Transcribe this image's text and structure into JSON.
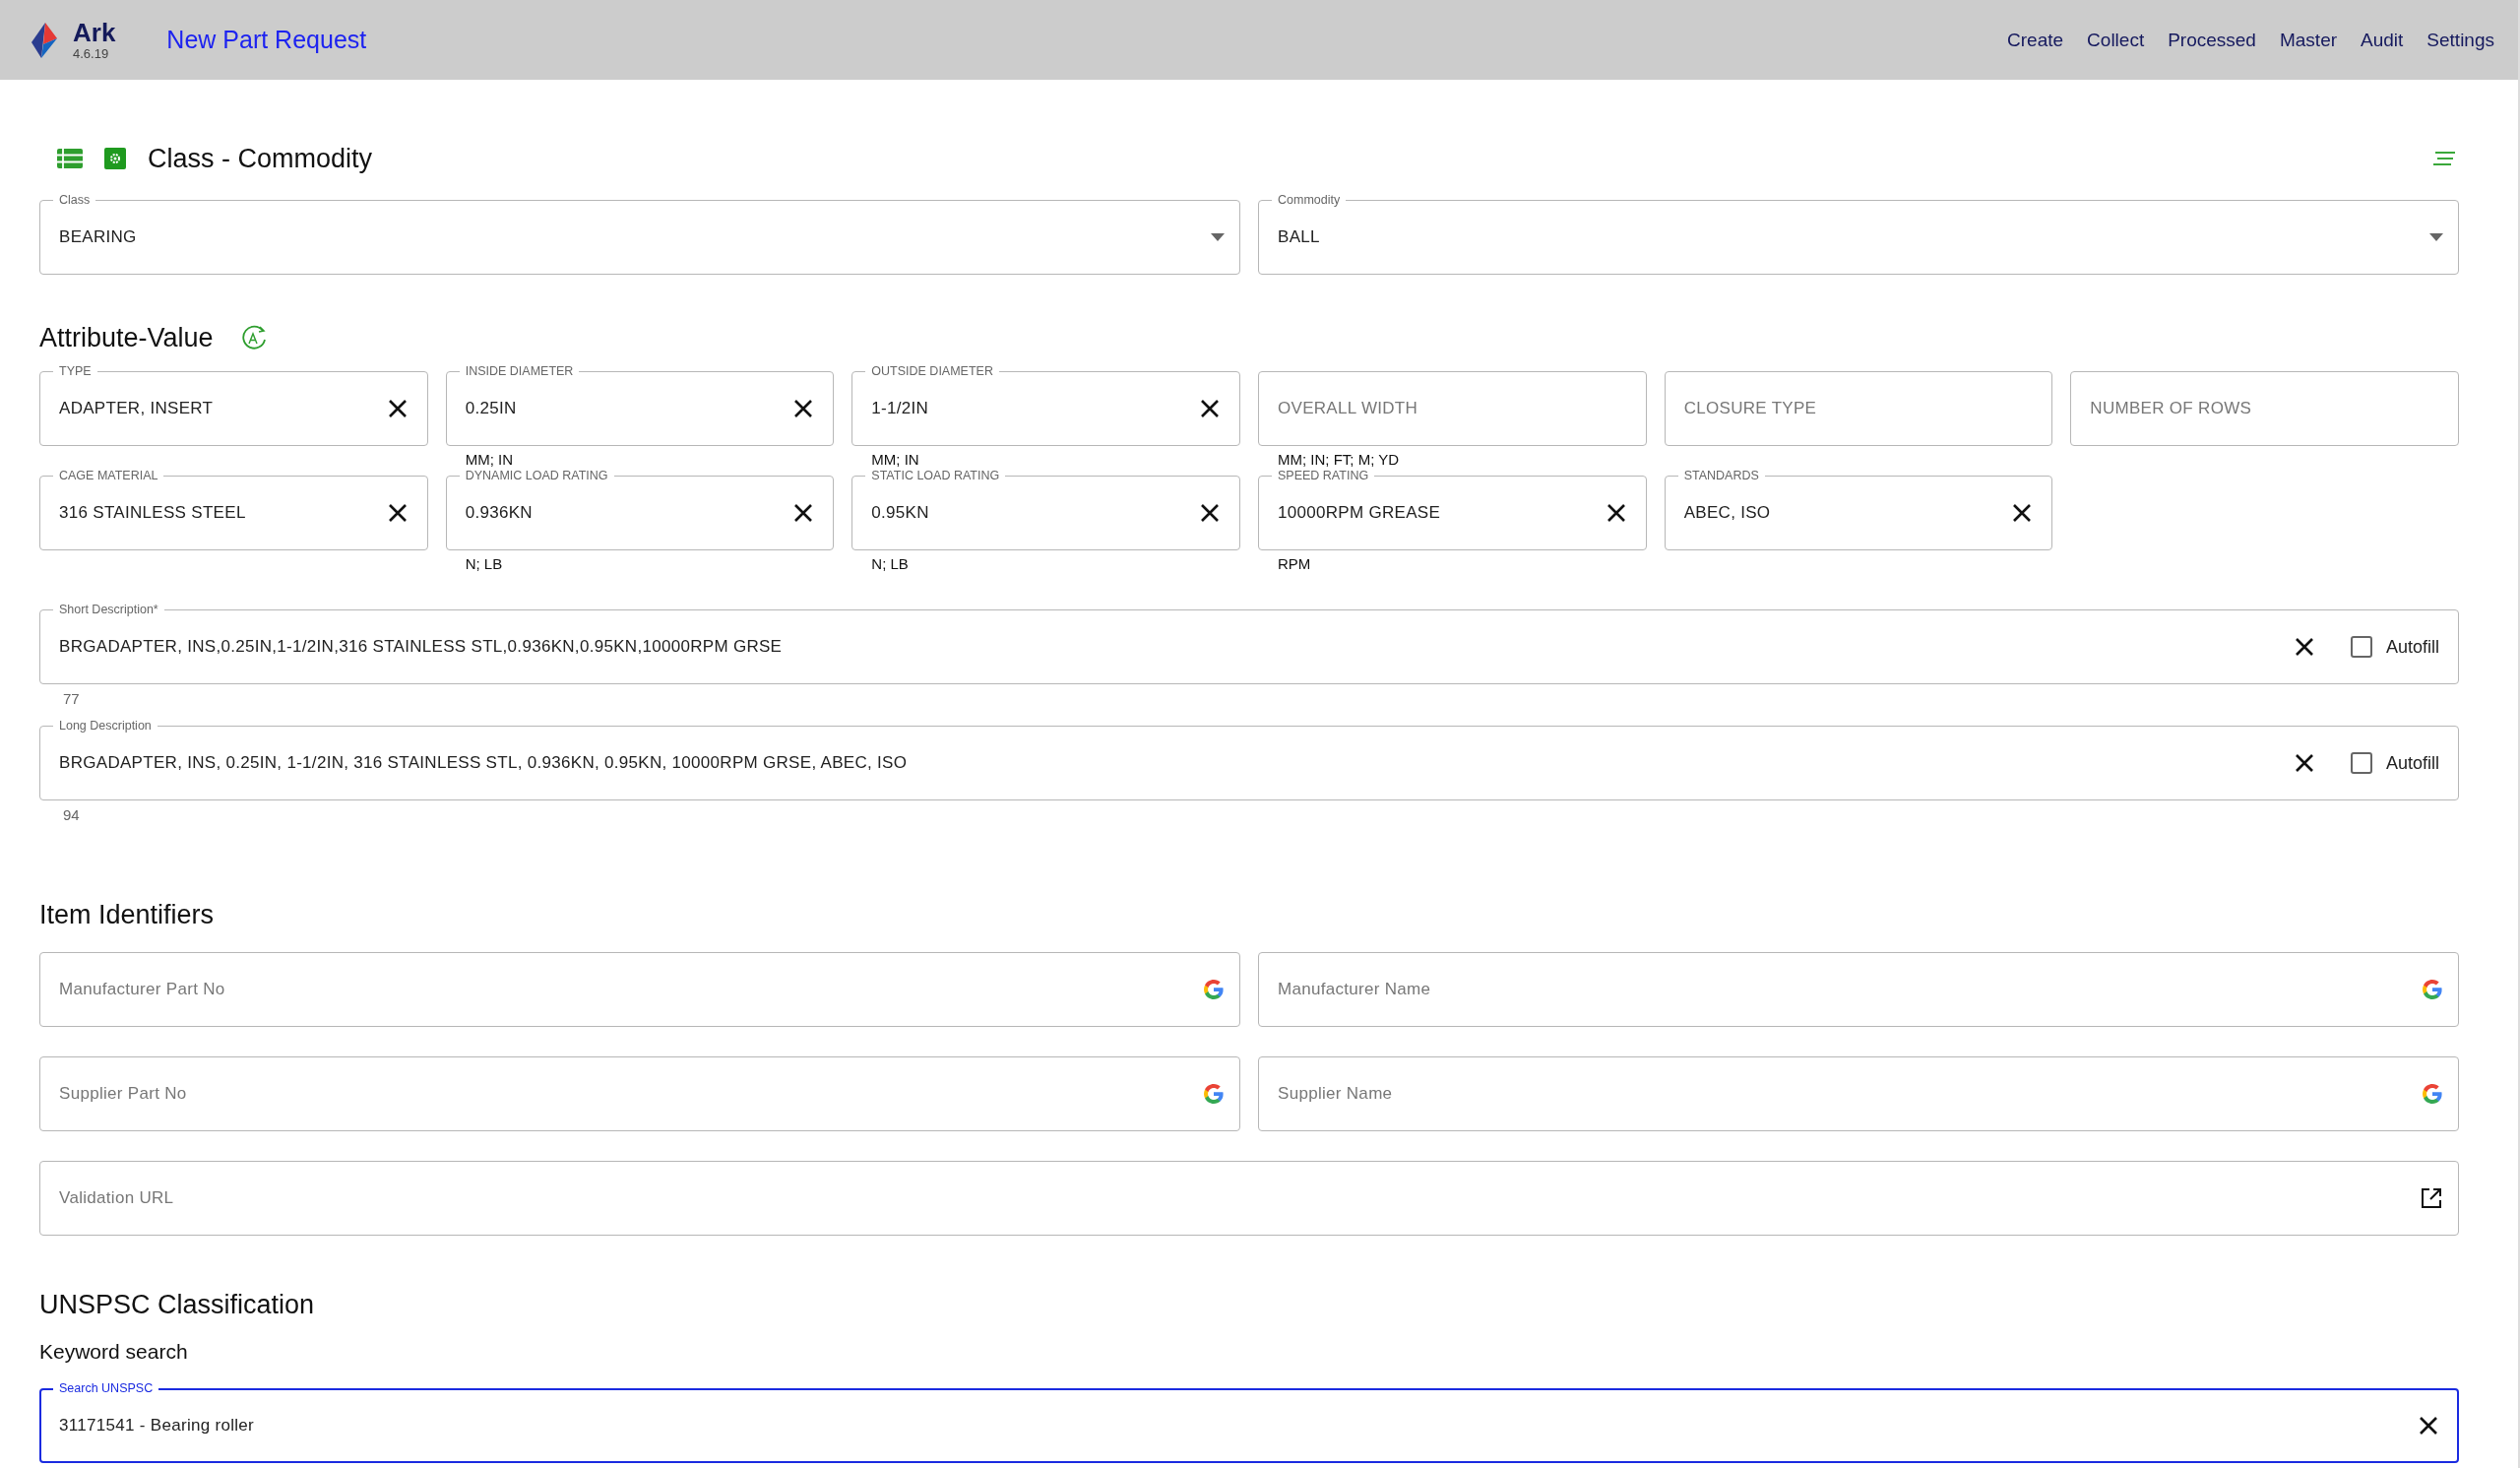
{
  "header": {
    "app_name": "Ark",
    "version": "4.6.19",
    "page_title": "New Part Request",
    "nav": [
      {
        "label": "Create"
      },
      {
        "label": "Collect"
      },
      {
        "label": "Processed"
      },
      {
        "label": "Master"
      },
      {
        "label": "Audit"
      },
      {
        "label": "Settings"
      }
    ]
  },
  "class_commodity": {
    "title": "Class - Commodity",
    "fields": [
      {
        "label": "Class",
        "value": "BEARING"
      },
      {
        "label": "Commodity",
        "value": "BALL"
      }
    ]
  },
  "attribute_value": {
    "title": "Attribute-Value",
    "attributes": [
      {
        "label": "TYPE",
        "value": "ADAPTER, INSERT"
      },
      {
        "label": "INSIDE DIAMETER",
        "value": "0.25IN",
        "hint": "MM; IN"
      },
      {
        "label": "OUTSIDE DIAMETER",
        "value": "1-1/2IN",
        "hint": "MM; IN"
      },
      {
        "placeholder": "OVERALL WIDTH",
        "hint": "MM; IN; FT; M; YD"
      },
      {
        "placeholder": "CLOSURE TYPE"
      },
      {
        "placeholder": "NUMBER OF ROWS"
      },
      {
        "label": "CAGE MATERIAL",
        "value": "316 STAINLESS STEEL"
      },
      {
        "label": "DYNAMIC LOAD RATING",
        "value": "0.936KN",
        "hint": "N; LB"
      },
      {
        "label": "STATIC LOAD RATING",
        "value": "0.95KN",
        "hint": "N; LB"
      },
      {
        "label": "SPEED RATING",
        "value": "10000RPM GREASE",
        "hint": "RPM"
      },
      {
        "label": "STANDARDS",
        "value": "ABEC, ISO"
      }
    ]
  },
  "descriptions": [
    {
      "label": "Short Description*",
      "value": "BRGADAPTER, INS,0.25IN,1-1/2IN,316 STAINLESS STL,0.936KN,0.95KN,10000RPM GRSE",
      "count": "77",
      "autofill_label": "Autofill",
      "autofill": false
    },
    {
      "label": "Long Description",
      "value": "BRGADAPTER, INS, 0.25IN, 1-1/2IN, 316 STAINLESS STL, 0.936KN, 0.95KN, 10000RPM GRSE, ABEC, ISO",
      "count": "94",
      "autofill_label": "Autofill",
      "autofill": false
    }
  ],
  "item_identifiers": {
    "title": "Item Identifiers",
    "fields": [
      {
        "placeholder": "Manufacturer Part No",
        "kind": "search"
      },
      {
        "placeholder": "Manufacturer Name",
        "kind": "search"
      },
      {
        "placeholder": "Supplier Part No",
        "kind": "search"
      },
      {
        "placeholder": "Supplier Name",
        "kind": "search"
      },
      {
        "placeholder": "Validation URL",
        "kind": "link"
      }
    ]
  },
  "unspsc": {
    "title": "UNSPSC Classification",
    "subtitle": "Keyword search",
    "search": {
      "label": "Search UNSPSC",
      "value": "31171541 - Bearing roller",
      "focused": true
    }
  }
}
